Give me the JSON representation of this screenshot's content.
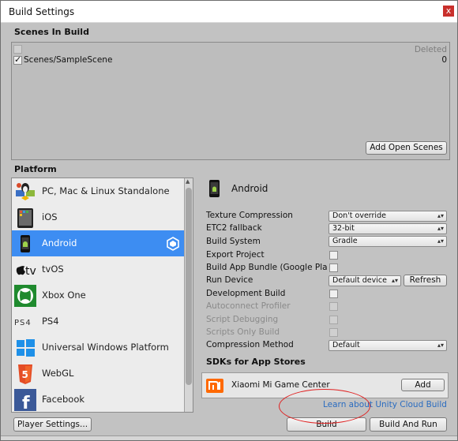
{
  "window": {
    "title": "Build Settings",
    "close_glyph": "x"
  },
  "scenes": {
    "section_label": "Scenes In Build",
    "deleted_header": "Deleted",
    "items": [
      {
        "name": "Scenes/SampleScene",
        "index": "0",
        "checked": true
      }
    ],
    "add_open_scenes_label": "Add Open Scenes"
  },
  "platform": {
    "section_label": "Platform",
    "items": [
      {
        "label": "PC, Mac & Linux Standalone",
        "icon": "pc-mac-linux-icon"
      },
      {
        "label": "iOS",
        "icon": "ios-icon"
      },
      {
        "label": "Android",
        "icon": "android-icon",
        "selected": true
      },
      {
        "label": "tvOS",
        "icon": "tvos-icon"
      },
      {
        "label": "Xbox One",
        "icon": "xbox-icon"
      },
      {
        "label": "PS4",
        "icon": "ps4-icon"
      },
      {
        "label": "Universal Windows Platform",
        "icon": "windows-icon"
      },
      {
        "label": "WebGL",
        "icon": "html5-icon"
      },
      {
        "label": "Facebook",
        "icon": "facebook-icon"
      }
    ]
  },
  "android": {
    "header": "Android",
    "texture_compression": {
      "label": "Texture Compression",
      "value": "Don't override"
    },
    "etc2_fallback": {
      "label": "ETC2 fallback",
      "value": "32-bit"
    },
    "build_system": {
      "label": "Build System",
      "value": "Gradle"
    },
    "export_project": {
      "label": "Export Project"
    },
    "build_app_bundle": {
      "label": "Build App Bundle (Google Play)"
    },
    "run_device": {
      "label": "Run Device",
      "value": "Default device",
      "refresh_label": "Refresh"
    },
    "development_build": {
      "label": "Development Build"
    },
    "autoconnect_profiler": {
      "label": "Autoconnect Profiler"
    },
    "script_debugging": {
      "label": "Script Debugging"
    },
    "scripts_only_build": {
      "label": "Scripts Only Build"
    },
    "compression_method": {
      "label": "Compression Method",
      "value": "Default"
    }
  },
  "sdks": {
    "section_label": "SDKs for App Stores",
    "items": [
      {
        "name": "Xiaomi Mi Game Center",
        "add_label": "Add"
      }
    ],
    "cloud_build_link": "Learn about Unity Cloud Build"
  },
  "footer": {
    "player_settings_label": "Player Settings...",
    "build_label": "Build",
    "build_and_run_label": "Build And Run"
  },
  "colors": {
    "selection": "#3d8df2",
    "link": "#2a6cc0",
    "annotation_ellipse": "#e02020"
  }
}
